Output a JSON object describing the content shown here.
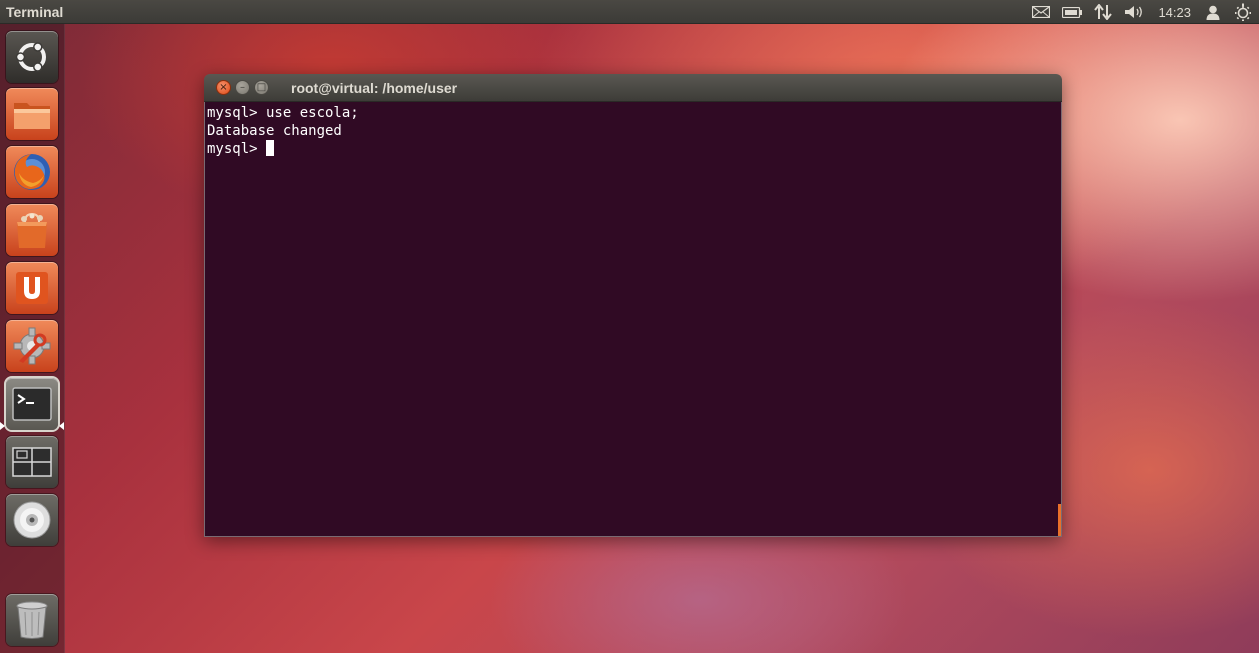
{
  "panel": {
    "app_title": "Terminal",
    "clock": "14:23",
    "indicators": [
      "mail-icon",
      "battery-icon",
      "network-icon",
      "volume-icon",
      "user-icon",
      "settings-icon"
    ]
  },
  "launcher": {
    "items": [
      {
        "name": "dash-home",
        "icon": "ubuntu-logo-icon"
      },
      {
        "name": "files",
        "icon": "folder-icon"
      },
      {
        "name": "firefox",
        "icon": "firefox-icon"
      },
      {
        "name": "software-center",
        "icon": "shopping-bag-icon"
      },
      {
        "name": "ubuntu-one",
        "icon": "ubuntu-one-icon"
      },
      {
        "name": "system-settings",
        "icon": "system-settings-icon"
      },
      {
        "name": "terminal",
        "icon": "terminal-icon",
        "active": true
      },
      {
        "name": "workspace-switcher",
        "icon": "workspace-icon"
      },
      {
        "name": "dvd",
        "icon": "disc-icon"
      },
      {
        "name": "trash",
        "icon": "trash-icon"
      }
    ]
  },
  "window": {
    "title": "root@virtual: /home/user",
    "buttons": [
      "close",
      "minimize",
      "maximize"
    ],
    "lines": [
      "mysql> use escola;",
      "Database changed",
      "mysql> "
    ]
  },
  "colors": {
    "terminal_bg": "#300a24",
    "panel_bg": "#3c3b37",
    "close_button": "#df4a16"
  }
}
